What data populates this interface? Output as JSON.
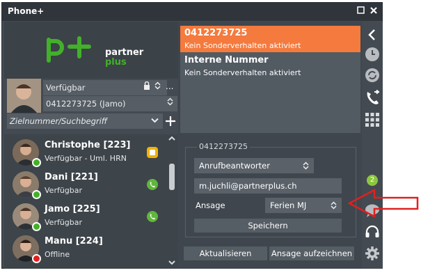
{
  "window": {
    "title": "Phone+"
  },
  "logo": {
    "brand_top": "partner",
    "brand_bottom": "plus"
  },
  "me": {
    "status": "Verfügbar",
    "line": "0412273725 (Jamo)",
    "search_placeholder": "Zielnummer/Suchbegriff",
    "more": "..."
  },
  "contacts": [
    {
      "name": "Christophe [223]",
      "status": "Verfügbar - Uml. HRN",
      "badge_color": "#43b02a",
      "action_color": "#f0b400"
    },
    {
      "name": "Dani [221]",
      "status": "Verfügbar",
      "badge_color": "#43b02a",
      "action_color": "#5fb83a"
    },
    {
      "name": "Jamo [225]",
      "status": "Verfügbar",
      "badge_color": "#43b02a",
      "action_color": "#5fb83a"
    },
    {
      "name": "Manu [224]",
      "status": "Offline",
      "badge_color": "#e02020",
      "action_color": ""
    }
  ],
  "cards": {
    "primary_number": "0412273725",
    "primary_sub": "Kein Sonderverhalten aktiviert",
    "secondary_title": "Interne Nummer",
    "secondary_sub": "Kein Sonderverhalten aktiviert"
  },
  "config": {
    "legend": "0412273725",
    "mode_select": "Anrufbeantworter",
    "email": "m.juchli@partnerplus.ch",
    "ansage_label": "Ansage",
    "ansage_select": "Ferien MJ",
    "save_button": "Speichern"
  },
  "footer": {
    "refresh_button": "Aktualisieren",
    "record_button": "Ansage aufzeichnen"
  },
  "sidebar": {
    "chat_badge": "2"
  },
  "colors": {
    "accent_orange": "#f47a3d",
    "brand_green": "#43b02a",
    "annotation_red": "#e02020"
  }
}
